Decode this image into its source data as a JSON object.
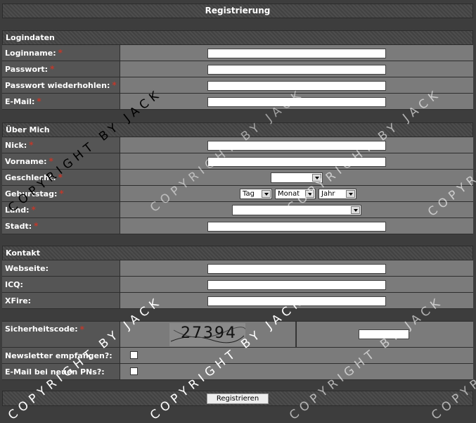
{
  "form": {
    "title": "Registrierung",
    "sections": {
      "login": "Logindaten",
      "about": "Über Mich",
      "contact": "Kontakt"
    },
    "fields": {
      "loginname": "Loginname:",
      "passwort": "Passwort:",
      "passwort_wdh": "Passwort wiederhohlen:",
      "email": "E-Mail:",
      "nick": "Nick:",
      "vorname": "Vorname:",
      "geschlecht": "Geschlecht:",
      "geburtstag": "Geburtstag:",
      "land": "Land:",
      "stadt": "Stadt:",
      "webseite": "Webseite:",
      "icq": "ICQ:",
      "xfire": "XFire:",
      "sicherheitscode": "Sicherheitscode:",
      "newsletter": "Newsletter empfangen?:",
      "email_pn": "E-Mail bei neuen PNs?:"
    },
    "required_mark": "*",
    "birthday": {
      "day": "Tag",
      "month": "Monat",
      "year": "Jahr"
    },
    "captcha_text": "27394",
    "submit_label": "Registrieren"
  },
  "watermark": "COPYRIGHT BY JACK"
}
